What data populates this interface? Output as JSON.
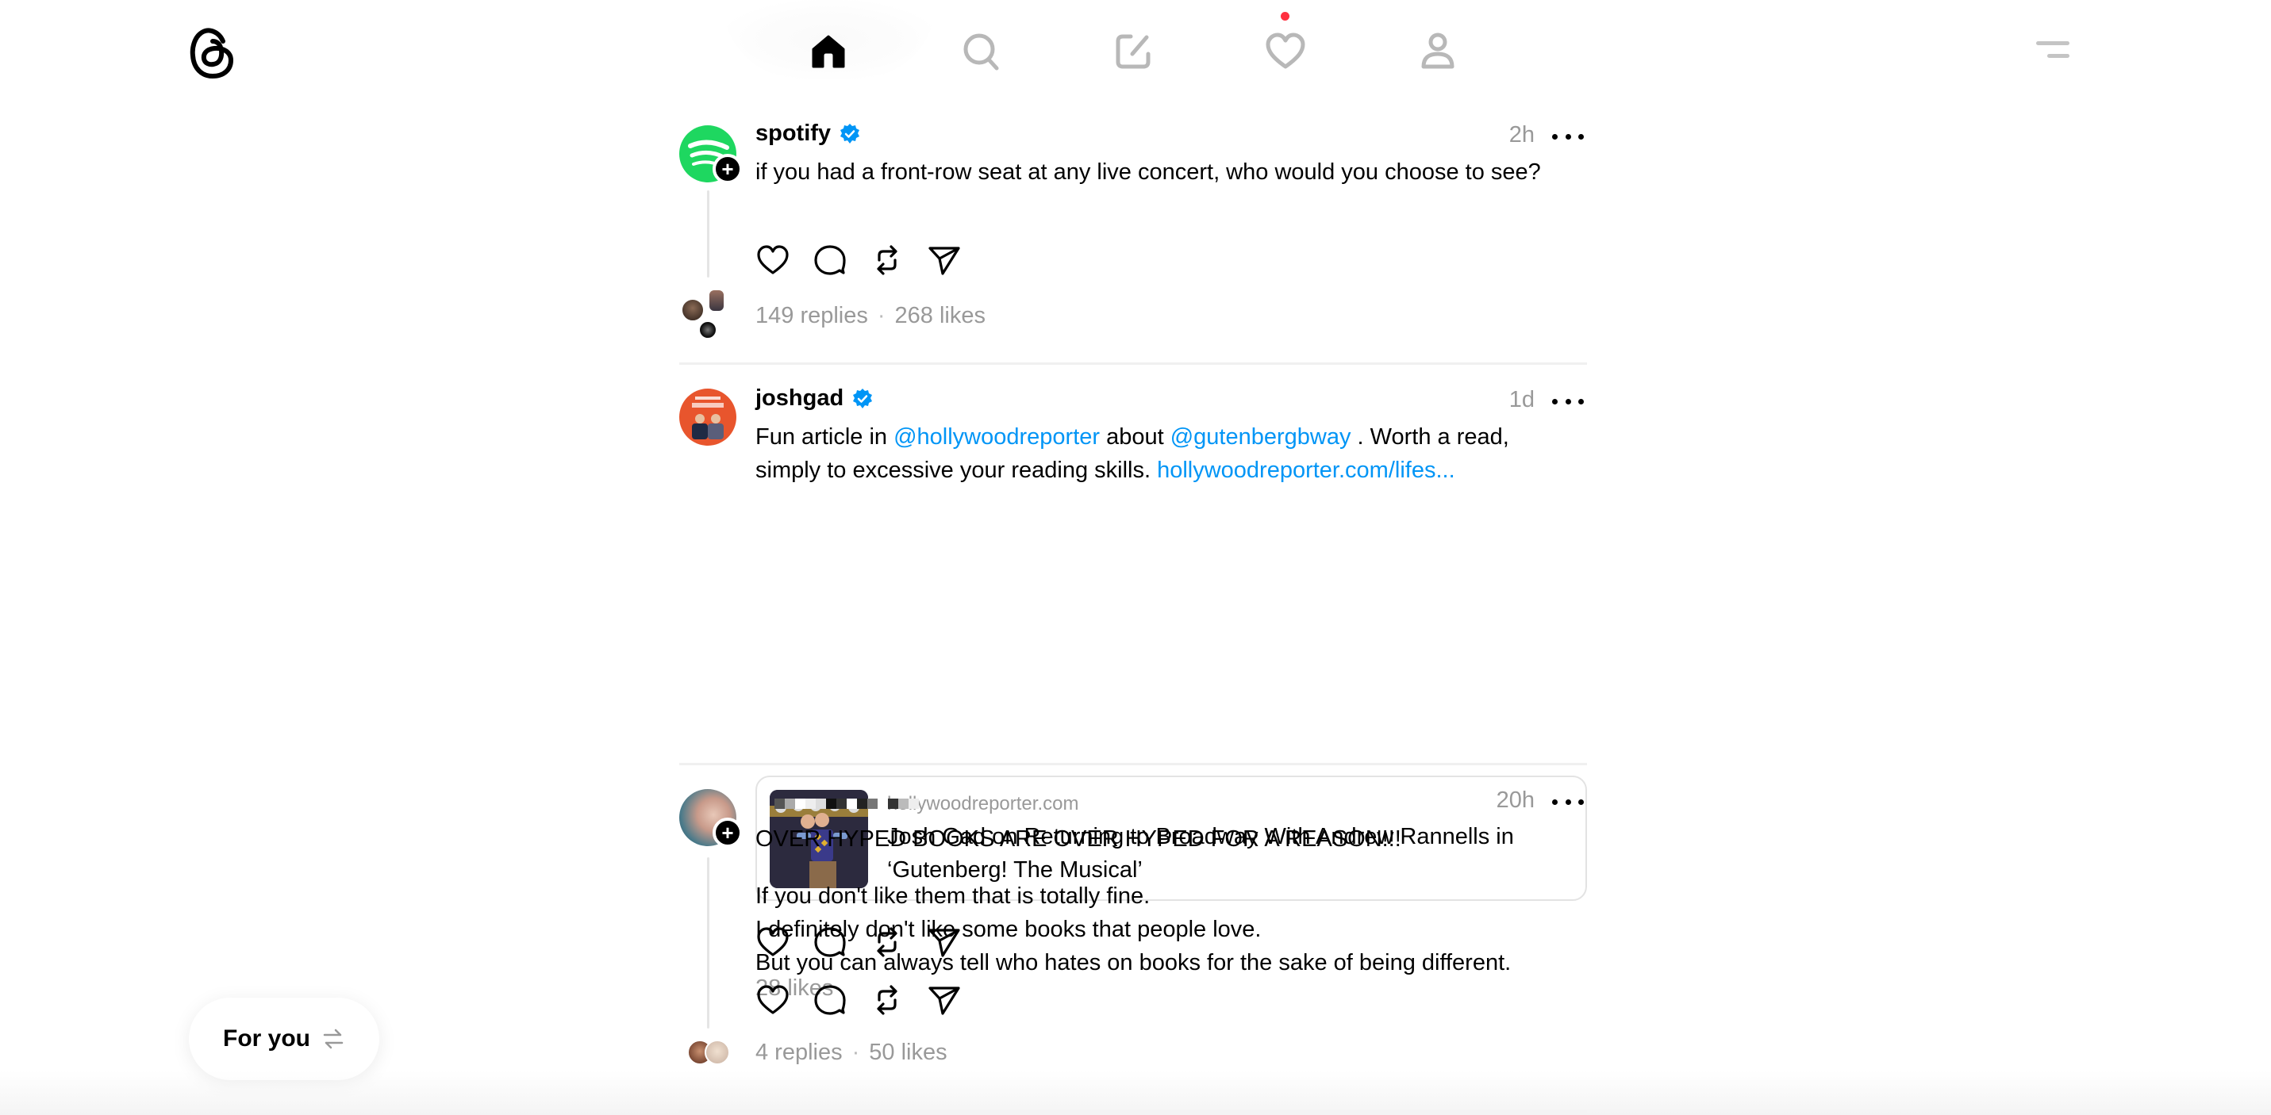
{
  "app": {
    "name": "Threads",
    "logo_icon": "threads-logo-icon"
  },
  "nav": {
    "items": [
      {
        "name": "home",
        "icon": "home-icon",
        "active": true
      },
      {
        "name": "search",
        "icon": "search-icon",
        "active": false
      },
      {
        "name": "create",
        "icon": "compose-icon",
        "active": false
      },
      {
        "name": "activity",
        "icon": "heart-icon",
        "active": false,
        "has_notification": true
      },
      {
        "name": "profile",
        "icon": "user-icon",
        "active": false
      }
    ],
    "menu_icon": "menu-icon"
  },
  "colors": {
    "accent_link": "#0095f6",
    "verified": "#0095f6",
    "notification_dot": "#ff3040",
    "muted_text": "#999999",
    "spotify_green": "#1ed760",
    "joshgad_avatar_bg": "#e8552d"
  },
  "posts": [
    {
      "username": "spotify",
      "verified": true,
      "time": "2h",
      "text": "if you had a front-row seat at any live concert, who would you choose to see?",
      "replies": "149 replies",
      "likes": "268 likes",
      "has_follow_badge": true
    },
    {
      "username": "joshgad",
      "verified": true,
      "time": "1d",
      "text_parts": {
        "p1": "Fun article in ",
        "mention1": "@hollywoodreporter",
        "p2": " about ",
        "mention2": "@gutenbergbway",
        "p3": " . Worth a read, simply to excessive your reading skills. ",
        "link": "hollywoodreporter.com/lifes..."
      },
      "link_card": {
        "domain": "hollywoodreporter.com",
        "title": "Josh Gad on Returning to Broadway With Andrew Rannells in ‘Gutenberg! The Musical’"
      },
      "likes": "28 likes"
    },
    {
      "username": "[redacted]",
      "verified": false,
      "time": "20h",
      "headline": "OVER HYPED BOOKS ARE OVER HYPED FOR A REASON!!!",
      "lines": [
        "If you don't like them that is totally fine.",
        "I definitely don't like some books that people love.",
        "But you can always tell who hates on books for the sake of being different."
      ],
      "replies": "4 replies",
      "likes": "50 likes",
      "has_follow_badge": true
    }
  ],
  "stats_separator": "·",
  "feed_switcher": {
    "label": "For you",
    "icon": "swap-arrows-icon"
  }
}
